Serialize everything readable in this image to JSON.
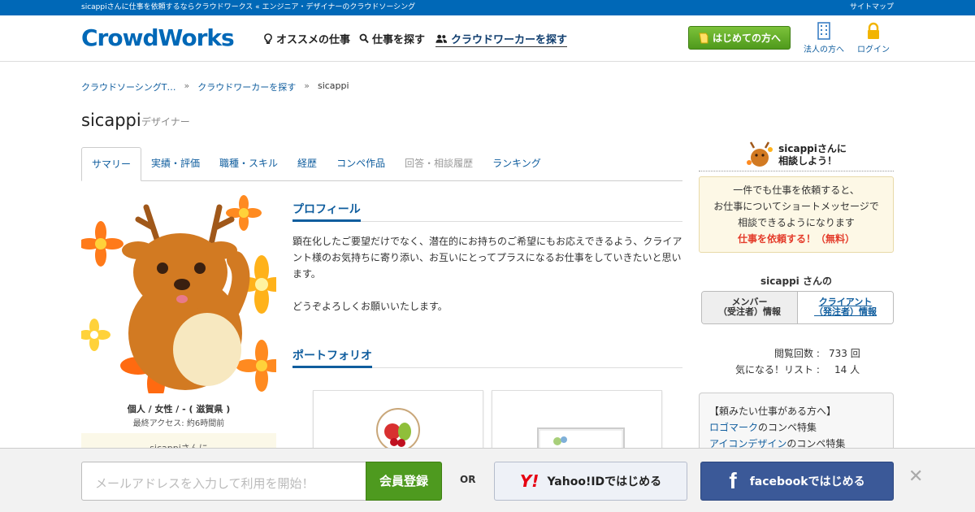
{
  "topbar": {
    "tagline": "sicappiさんに仕事を依頼するならクラウドワークス « エンジニア・デザイナーのクラウドソーシング",
    "sitemap": "サイトマップ"
  },
  "header": {
    "logo": "CrowdWorks",
    "nav": [
      {
        "label": "オススメの仕事",
        "icon": "bulb-icon"
      },
      {
        "label": "仕事を探す",
        "icon": "search-icon"
      },
      {
        "label": "クラウドワーカーを探す",
        "icon": "users-icon"
      }
    ],
    "start_button": "はじめての方へ",
    "corporate": "法人の方へ",
    "login": "ログイン"
  },
  "breadcrumb": [
    "クラウドソーシングT…",
    "クラウドワーカーを探す",
    "sicappi"
  ],
  "profile": {
    "name": "sicappi",
    "type": "デザイナー",
    "meta": "個人 / 女性 / - ( 滋賀県 )",
    "last_access": "最終アクセス: 約6時間前",
    "left_box": "sicappiさんに"
  },
  "tabs": [
    {
      "label": "サマリー",
      "state": "active"
    },
    {
      "label": "実績・評価",
      "state": "normal"
    },
    {
      "label": "職種・スキル",
      "state": "normal"
    },
    {
      "label": "経歴",
      "state": "normal"
    },
    {
      "label": "コンペ作品",
      "state": "normal"
    },
    {
      "label": "回答・相談履歴",
      "state": "muted"
    },
    {
      "label": "ランキング",
      "state": "normal"
    }
  ],
  "sections": {
    "profile_title": "プロフィール",
    "bio_p1": "顕在化したご要望だけでなく、潜在的にお持ちのご希望にもお応えできるよう、クライアント様のお気持ちに寄り添い、お互いにとってプラスになるお仕事をしていきたいと思います。",
    "bio_p2": "どうぞよろしくお願いいたします。",
    "portfolio_title": "ポートフォリオ"
  },
  "sidebar": {
    "consult_line1": "sicappiさんに",
    "consult_line2": "相談しよう！",
    "box_line1": "一件でも仕事を依頼すると、",
    "box_line2": "お仕事についてショートメッセージで",
    "box_line3": "相談できるようになります",
    "box_cta": "仕事を依頼する！（無料）",
    "whose": "sicappi さんの",
    "toggle_member_1": "メンバー",
    "toggle_member_2": "（受注者）情報",
    "toggle_client_1": "クライアント",
    "toggle_client_2": "（発注者）情報",
    "views_label": "閲覧回数 :",
    "views_value": "733 回",
    "fav_label": "気になる！リスト :",
    "fav_value": "14 人",
    "req_title": "【頼みたい仕事がある方へ】",
    "req_link1": "ロゴマーク",
    "req_suffix1": "のコンペ特集",
    "req_link2": "アイコンデザイン",
    "req_suffix2": "のコンペ特集"
  },
  "bottombar": {
    "email_placeholder": "メールアドレスを入力して利用を開始！",
    "register": "会員登録",
    "or": "OR",
    "yahoo_logo": "Y!",
    "yahoo": "Yahoo!IDではじめる",
    "facebook_logo": "f",
    "facebook": "facebookではじめる",
    "close": "✕"
  },
  "colors": {
    "brand": "#0068b7",
    "green": "#4e9a1f",
    "facebook": "#3b5998",
    "red": "#e43c2b"
  }
}
